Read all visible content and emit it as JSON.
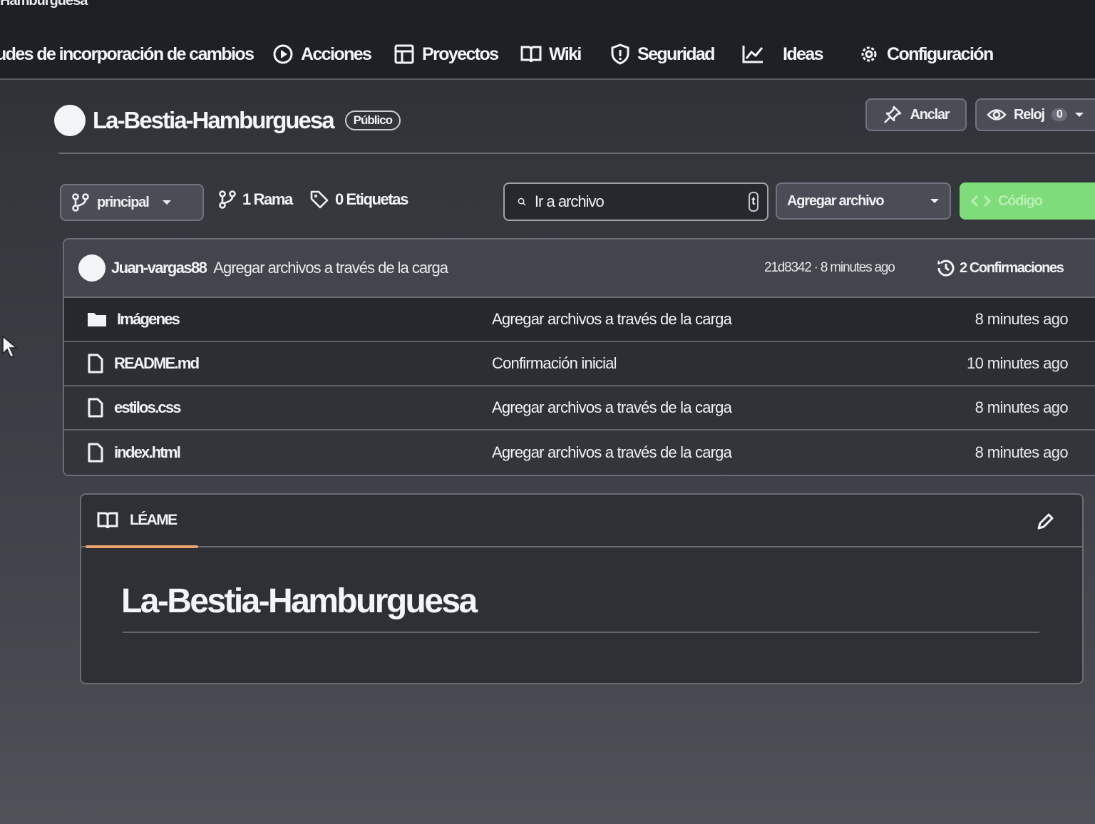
{
  "window": {
    "title_fragment": "Hamburguesa"
  },
  "nav": {
    "items": [
      {
        "label": "udes de incorporación de cambios",
        "icon": "pull-request-icon"
      },
      {
        "label": "Acciones",
        "icon": "play-circle-icon"
      },
      {
        "label": "Proyectos",
        "icon": "table-icon"
      },
      {
        "label": "Wiki",
        "icon": "book-icon"
      },
      {
        "label": "Seguridad",
        "icon": "shield-icon"
      },
      {
        "label": "Ideas",
        "icon": "graph-icon"
      },
      {
        "label": "Configuración",
        "icon": "gear-icon"
      }
    ]
  },
  "repo": {
    "name": "La-Bestia-Hamburguesa",
    "visibility": "Público",
    "pin_label": "Anclar",
    "watch_label": "Reloj",
    "watch_count": "0"
  },
  "toolbar": {
    "branch": "principal",
    "branches": "1 Rama",
    "tags": "0 Etiquetas",
    "search_placeholder": "Ir a archivo",
    "search_key": "t",
    "add_file": "Agregar archivo",
    "code": "Código"
  },
  "latest_commit": {
    "author": "Juan-vargas88",
    "message": "Agregar archivos a través de la carga",
    "sha_time": "21d8342 · 8 minutes ago",
    "commits": "2 Confirmaciones"
  },
  "files": [
    {
      "name": "Imágenes",
      "type": "folder",
      "message": "Agregar archivos a través de la carga",
      "age": "8 minutes ago"
    },
    {
      "name": "README.md",
      "type": "file",
      "message": "Confirmación inicial",
      "age": "10 minutes ago"
    },
    {
      "name": "estilos.css",
      "type": "file",
      "message": "Agregar archivos a través de la carga",
      "age": "8 minutes ago"
    },
    {
      "name": "index.html",
      "type": "file",
      "message": "Agregar archivos a través de la carga",
      "age": "8 minutes ago"
    }
  ],
  "readme": {
    "tab": "LÉAME",
    "heading": "La-Bestia-Hamburguesa"
  },
  "colors": {
    "code_button": "#7fdc7a",
    "readme_tab_underline": "#e8a36b",
    "topbar": "#1e2026"
  }
}
